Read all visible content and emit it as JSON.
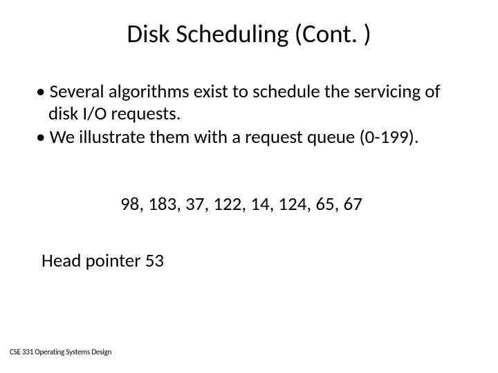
{
  "title": "Disk Scheduling (Cont. )",
  "bullets": [
    "Several algorithms exist to schedule the servicing of disk I/O requests.",
    "We illustrate them with a request queue (0-199)."
  ],
  "queue_line": "98, 183, 37, 122, 14, 124, 65, 67",
  "head_pointer_line": "Head pointer 53",
  "footer": "CSE 331 Operating Systems Design"
}
